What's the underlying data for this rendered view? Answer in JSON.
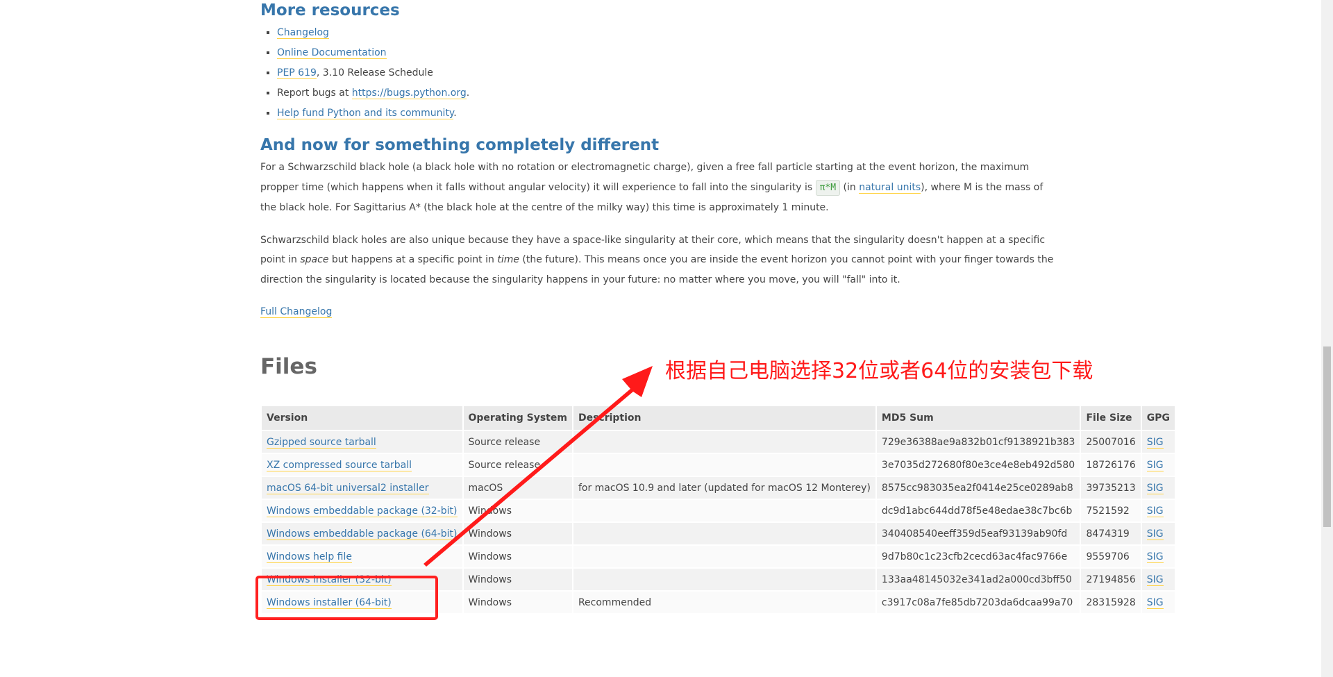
{
  "resources": {
    "heading": "More resources",
    "items": [
      {
        "link": "Changelog",
        "rest": ""
      },
      {
        "link": "Online Documentation",
        "rest": ""
      },
      {
        "link": "PEP 619",
        "rest": ", 3.10 Release Schedule"
      },
      {
        "prefix": "Report bugs at ",
        "link": "https://bugs.python.org",
        "rest": "."
      },
      {
        "link": "Help fund Python and its community",
        "rest": "."
      }
    ]
  },
  "different": {
    "heading": "And now for something completely different",
    "p1": {
      "part1": "For a Schwarzschild black hole (a black hole with no rotation or electromagnetic charge), given a free fall particle starting at the event horizon, the maximum propper time (which happens when it falls without angular velocity) it will experience to fall into the singularity is ",
      "math": "π*M",
      "part2": " (in ",
      "link": "natural units",
      "part3": "), where M is the mass of the black hole. For Sagittarius A* (the black hole at the centre of the milky way) this time is approximately 1 minute."
    },
    "p2": {
      "part1": "Schwarzschild black holes are also unique because they have a space-like singularity at their core, which means that the singularity doesn't happen at a specific point in ",
      "em1": "space",
      "part2": " but happens at a specific point in ",
      "em2": "time",
      "part3": " (the future). This means once you are inside the event horizon you cannot point with your finger towards the direction the singularity is located because the singularity happens in your future: no matter where you move, you will \"fall\" into it."
    },
    "full_changelog": "Full Changelog"
  },
  "files": {
    "heading": "Files",
    "columns": [
      "Version",
      "Operating System",
      "Description",
      "MD5 Sum",
      "File Size",
      "GPG"
    ],
    "rows": [
      {
        "version": "Gzipped source tarball",
        "os": "Source release",
        "desc": "",
        "md5": "729e36388ae9a832b01cf9138921b383",
        "size": "25007016",
        "gpg": "SIG"
      },
      {
        "version": "XZ compressed source tarball",
        "os": "Source release",
        "desc": "",
        "md5": "3e7035d272680f80e3ce4e8eb492d580",
        "size": "18726176",
        "gpg": "SIG"
      },
      {
        "version": "macOS 64-bit universal2 installer",
        "os": "macOS",
        "desc": "for macOS 10.9 and later (updated for macOS 12 Monterey)",
        "md5": "8575cc983035ea2f0414e25ce0289ab8",
        "size": "39735213",
        "gpg": "SIG"
      },
      {
        "version": "Windows embeddable package (32-bit)",
        "os": "Windows",
        "desc": "",
        "md5": "dc9d1abc644dd78f5e48edae38c7bc6b",
        "size": "7521592",
        "gpg": "SIG"
      },
      {
        "version": "Windows embeddable package (64-bit)",
        "os": "Windows",
        "desc": "",
        "md5": "340408540eeff359d5eaf93139ab90fd",
        "size": "8474319",
        "gpg": "SIG"
      },
      {
        "version": "Windows help file",
        "os": "Windows",
        "desc": "",
        "md5": "9d7b80c1c23cfb2cecd63ac4fac9766e",
        "size": "9559706",
        "gpg": "SIG"
      },
      {
        "version": "Windows installer (32-bit)",
        "os": "Windows",
        "desc": "",
        "md5": "133aa48145032e341ad2a000cd3bff50",
        "size": "27194856",
        "gpg": "SIG"
      },
      {
        "version": "Windows installer (64-bit)",
        "os": "Windows",
        "desc": "Recommended",
        "md5": "c3917c08a7fe85db7203da6dcaa99a70",
        "size": "28315928",
        "gpg": "SIG"
      }
    ]
  },
  "annotation": {
    "text": "根据自己电脑选择32位或者64位的安装包下载",
    "color": "#ff1a1a"
  },
  "colors": {
    "link": "#3776ab",
    "link_underline": "#ffd343",
    "heading": "#3776ab"
  }
}
